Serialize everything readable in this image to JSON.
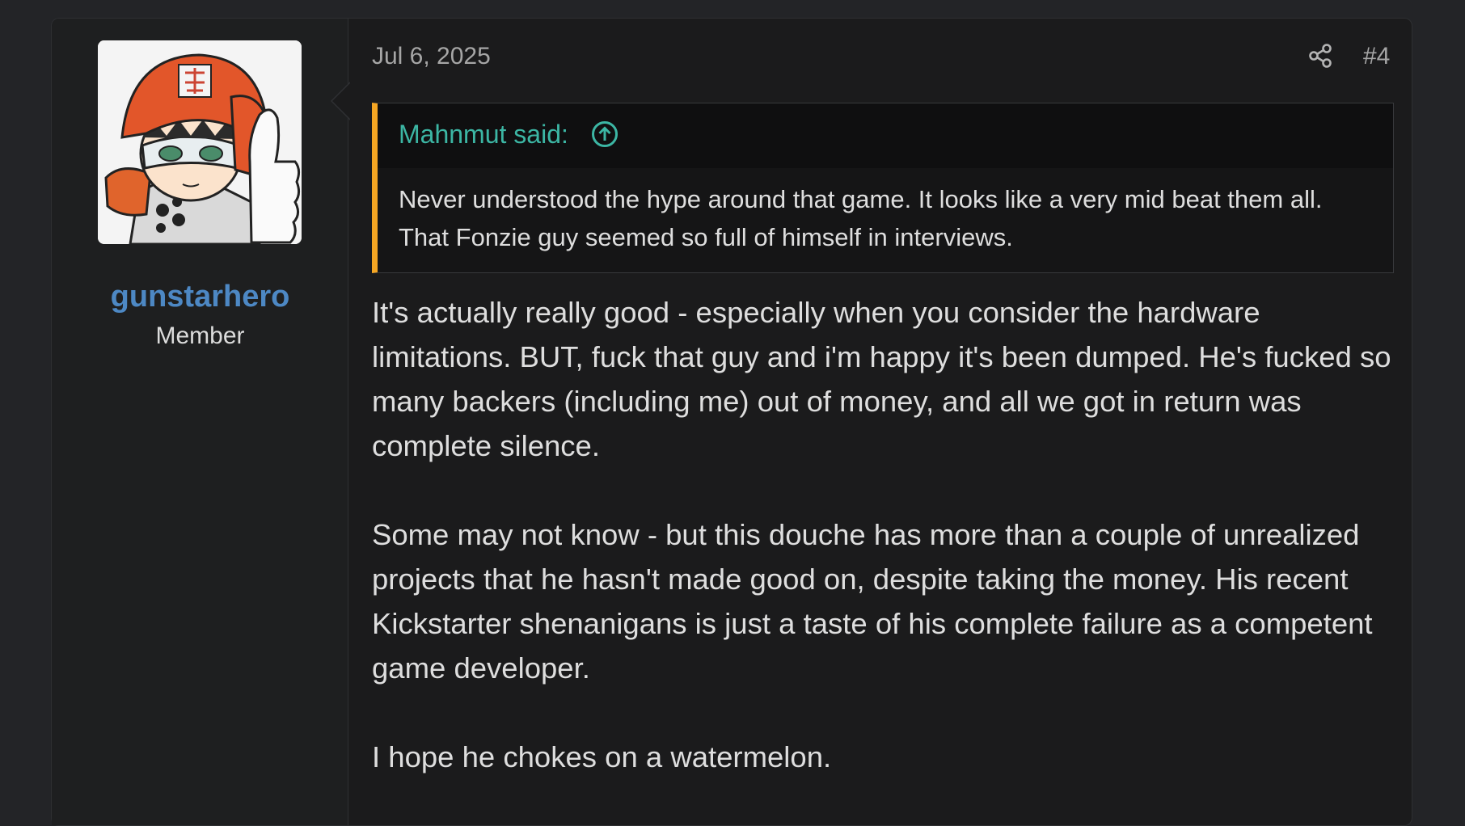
{
  "post": {
    "user": {
      "name": "gunstarhero",
      "title": "Member"
    },
    "date": "Jul 6, 2025",
    "number": "#4",
    "quote": {
      "author_label": "Mahnmut said:",
      "text": "Never understood the hype around that game. It looks like a very mid beat them all. That Fonzie guy seemed so full of himself in interviews."
    },
    "paragraphs": [
      "It's actually really good - especially when you consider the hardware limitations. BUT, fuck that guy and i'm happy it's been dumped. He's fucked so many backers (including me) out of money, and all we got in return was complete silence.",
      "Some may not know - but this douche has more than a couple of unrealized projects that he hasn't made good on, despite taking the money. His recent Kickstarter shenanigans is just a taste of his complete failure as a competent game developer.",
      "I hope he chokes on a watermelon."
    ],
    "icons": {
      "share": "share-icon",
      "quote_jump": "arrow-up-circle-icon"
    },
    "colors": {
      "username": "#4d88c4",
      "quote_author": "#3cb6a4",
      "quote_bar": "#f5a623",
      "background": "#232427",
      "post_bg": "#1b1b1c"
    }
  }
}
